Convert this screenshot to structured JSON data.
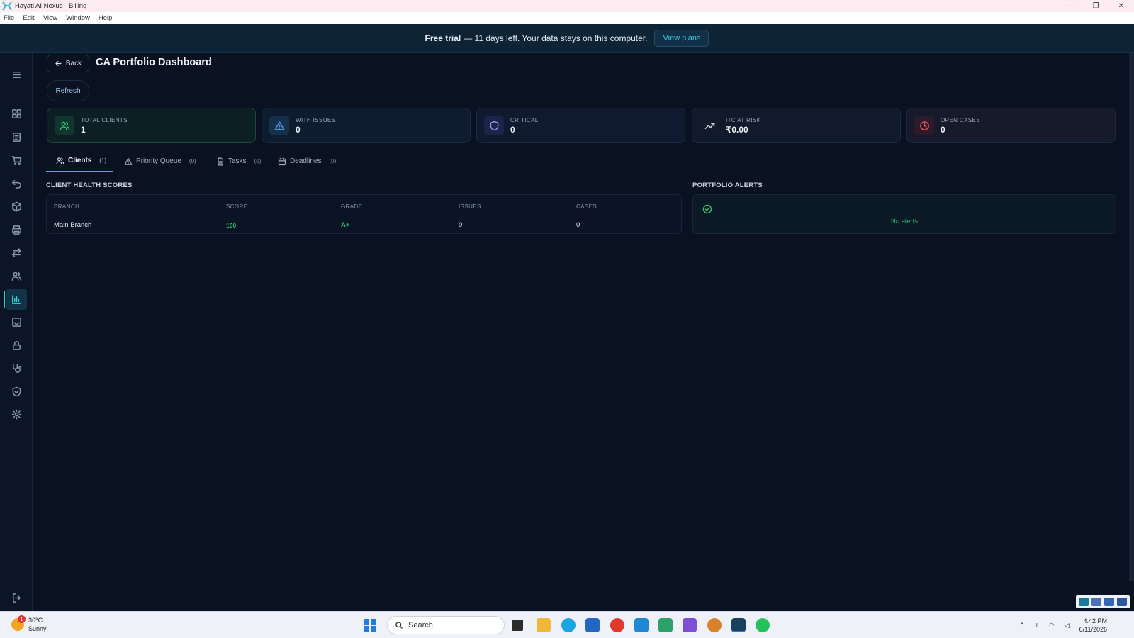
{
  "window": {
    "title": "Hayati AI Nexus - Billing",
    "controls": [
      "—",
      "❐",
      "✕"
    ]
  },
  "menu": [
    "File",
    "Edit",
    "View",
    "Window",
    "Help"
  ],
  "banner": {
    "bold": "Free trial",
    "text": "— 11 days left. Your data stays on this computer.",
    "button": "View plans"
  },
  "header": {
    "back_label": "Back",
    "title": "CA Portfolio Dashboard",
    "refresh_label": "Refresh"
  },
  "sidebar": {
    "items": [
      {
        "icon": "menu-icon"
      },
      {
        "icon": "grid-icon"
      },
      {
        "icon": "document-icon"
      },
      {
        "icon": "cart-icon"
      },
      {
        "icon": "undo-icon"
      },
      {
        "icon": "package-icon"
      },
      {
        "icon": "printer-icon"
      },
      {
        "icon": "transfer-icon"
      },
      {
        "icon": "users-icon"
      },
      {
        "icon": "chart-icon",
        "active": true
      },
      {
        "icon": "inbox-icon"
      },
      {
        "icon": "lock-icon"
      },
      {
        "icon": "stethoscope-icon"
      },
      {
        "icon": "shield-icon"
      },
      {
        "icon": "gear-icon"
      },
      {
        "icon": "logout-icon"
      }
    ]
  },
  "kpis": [
    {
      "label": "TOTAL CLIENTS",
      "value": "1",
      "icon": "users-icon",
      "color": "#2fbf6e"
    },
    {
      "label": "WITH ISSUES",
      "value": "0",
      "icon": "alert-triangle-icon",
      "color": "#4f8fd6"
    },
    {
      "label": "CRITICAL",
      "value": "0",
      "icon": "shield-icon",
      "color": "#7c8cf0"
    },
    {
      "label": "ITC AT RISK",
      "value": "₹0.00",
      "icon": "trending-up-icon",
      "color": "#cfd6e0"
    },
    {
      "label": "OPEN CASES",
      "value": "0",
      "icon": "clock-icon",
      "color": "#e0505a"
    }
  ],
  "tabs": [
    {
      "label": "Clients",
      "count": "(1)",
      "icon": "users-icon",
      "active": true
    },
    {
      "label": "Priority Queue",
      "count": "(0)",
      "icon": "alert-triangle-icon"
    },
    {
      "label": "Tasks",
      "count": "(0)",
      "icon": "file-icon"
    },
    {
      "label": "Deadlines",
      "count": "(0)",
      "icon": "calendar-icon"
    }
  ],
  "health": {
    "title": "CLIENT HEALTH SCORES",
    "columns": [
      "BRANCH",
      "SCORE",
      "GRADE",
      "ISSUES",
      "CASES"
    ],
    "rows": [
      {
        "branch": "Main Branch",
        "score": "100",
        "grade": "A+",
        "issues": "0",
        "cases": "0"
      }
    ]
  },
  "alerts": {
    "title": "PORTFOLIO ALERTS",
    "empty": "No alerts"
  },
  "taskbar": {
    "weather_temp": "36°C",
    "weather_desc": "Sunny",
    "weather_badge": "1",
    "search_label": "Search",
    "time": "4:42 PM",
    "date": "6/11/2026"
  },
  "colors": {
    "accent": "#2eb8d0",
    "success": "#2fbf6e",
    "background": "#0a1222"
  }
}
